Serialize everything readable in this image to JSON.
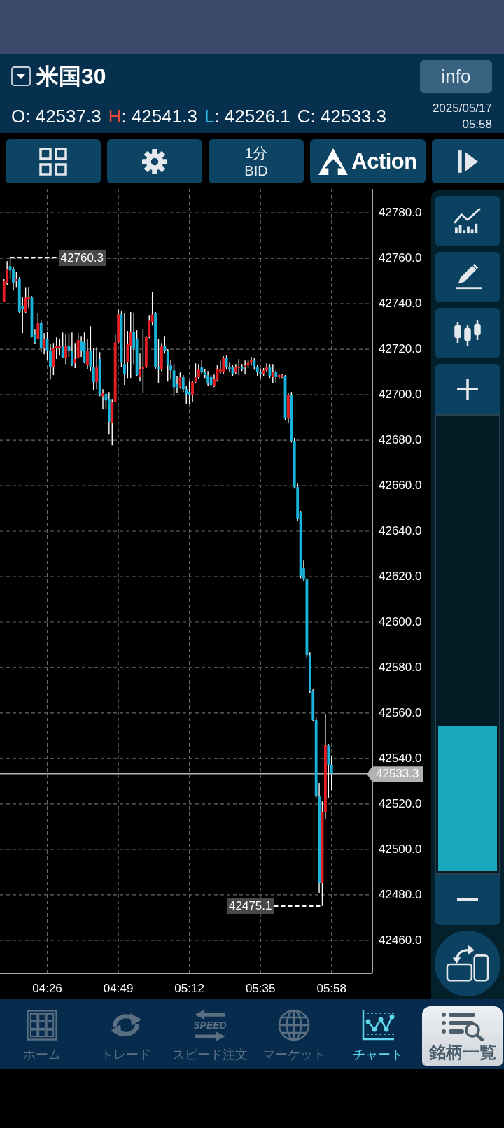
{
  "header": {
    "title": "米国30",
    "info_button": "info",
    "ohlc": [
      {
        "label": "O",
        "value": ": 42537.3",
        "color": "#ffffff"
      },
      {
        "label": "H",
        "value": ": 42541.3",
        "color": "#e8463c"
      },
      {
        "label": "L",
        "value": ": 42526.1",
        "color": "#29b6e8"
      },
      {
        "label": "C",
        "value": ": 42533.3",
        "color": "#ffffff"
      }
    ],
    "date": "2025/05/17",
    "time": "05:58"
  },
  "toolbar": [
    {
      "kind": "layout"
    },
    {
      "kind": "settings"
    },
    {
      "kind": "timeframe",
      "label": "1分",
      "sublabel": "BID"
    },
    {
      "kind": "action",
      "label": "Action"
    },
    {
      "kind": "forward"
    }
  ],
  "chart": {
    "chart_data": {
      "type": "candlestick",
      "x": [
        252,
        253,
        254,
        255,
        256,
        257,
        258,
        259,
        260,
        261,
        262,
        263,
        264,
        265,
        266,
        267,
        268,
        269,
        270,
        271,
        272,
        273,
        274,
        275,
        276,
        277,
        278,
        279,
        280,
        281,
        282,
        283,
        284,
        285,
        286,
        287,
        288,
        289,
        290,
        291,
        292,
        293,
        294,
        295,
        296,
        297,
        298,
        299,
        300,
        301,
        302,
        303,
        304,
        305,
        306,
        307,
        308,
        309,
        310,
        311,
        312,
        313,
        314,
        315,
        316,
        317,
        318,
        319,
        320,
        321,
        322,
        323,
        324,
        325,
        326,
        327,
        328,
        329,
        330,
        331,
        332,
        333,
        334,
        335,
        336,
        337,
        338,
        339,
        340,
        341,
        342,
        343,
        344,
        345,
        346,
        347,
        348,
        349,
        350,
        351,
        352,
        353,
        354,
        355,
        356,
        357,
        358
      ],
      "ohlc": [
        [
          42740.9,
          42751.0,
          42740.9,
          42750.1
        ],
        [
          42749.2,
          42758.7,
          42748.0,
          42755.3
        ],
        [
          42756.6,
          42760.3,
          42751.0,
          42754.7
        ],
        [
          42755.3,
          42756.0,
          42745.8,
          42749.2
        ],
        [
          42749.8,
          42754.1,
          42747.3,
          42751.0
        ],
        [
          42751.0,
          42751.7,
          42735.7,
          42736.3
        ],
        [
          42739.0,
          42743.0,
          42727.0,
          42737.8
        ],
        [
          42736.3,
          42747.3,
          42735.7,
          42742.7
        ],
        [
          42741.8,
          42747.3,
          42738.1,
          42743.0
        ],
        [
          42742.7,
          42743.3,
          42725.2,
          42725.5
        ],
        [
          42726.7,
          42728.9,
          42722.4,
          42723.0
        ],
        [
          42724.6,
          42736.0,
          42724.6,
          42731.7
        ],
        [
          42731.7,
          42732.6,
          42718.7,
          42720.3
        ],
        [
          42720.3,
          42727.0,
          42717.8,
          42724.6
        ],
        [
          42724.6,
          42727.7,
          42715.3,
          42719.3
        ],
        [
          42719.3,
          42722.1,
          42706.7,
          42712.0
        ],
        [
          42712.0,
          42722.7,
          42708.6,
          42720.3
        ],
        [
          42720.3,
          42725.2,
          42715.7,
          42721.5
        ],
        [
          42720.3,
          42724.3,
          42717.2,
          42721.5
        ],
        [
          42721.5,
          42727.3,
          42716.0,
          42716.3
        ],
        [
          42716.3,
          42726.4,
          42713.5,
          42721.5
        ],
        [
          42721.5,
          42727.0,
          42716.6,
          42719.3
        ],
        [
          42719.3,
          42727.3,
          42712.6,
          42712.9
        ],
        [
          42713.8,
          42722.7,
          42711.7,
          42715.7
        ],
        [
          42716.3,
          42727.0,
          42716.0,
          42724.0
        ],
        [
          42723.3,
          42725.8,
          42716.6,
          42719.3
        ],
        [
          42723.0,
          42727.3,
          42713.8,
          42714.1
        ],
        [
          42712.9,
          42724.6,
          42711.3,
          42719.3
        ],
        [
          42719.3,
          42730.1,
          42710.4,
          42712.0
        ],
        [
          42712.0,
          42720.6,
          42702.1,
          42705.5
        ],
        [
          42705.5,
          42720.9,
          42702.4,
          42712.0
        ],
        [
          42715.7,
          42718.7,
          42699.3,
          42699.7
        ],
        [
          42699.3,
          42702.4,
          42693.5,
          42700.6
        ],
        [
          42700.3,
          42700.6,
          42693.5,
          42697.5
        ],
        [
          42698.1,
          42701.2,
          42682.7,
          42688.0
        ],
        [
          42687.7,
          42698.1,
          42677.8,
          42696.6
        ],
        [
          42696.9,
          42726.4,
          42696.6,
          42723.0
        ],
        [
          42723.0,
          42737.5,
          42722.7,
          42735.3
        ],
        [
          42735.3,
          42736.6,
          42712.3,
          42714.1
        ],
        [
          42713.5,
          42736.0,
          42704.3,
          42708.9
        ],
        [
          42714.4,
          42728.0,
          42707.3,
          42722.1
        ],
        [
          42721.5,
          42736.3,
          42707.3,
          42727.7
        ],
        [
          42727.7,
          42736.0,
          42713.5,
          42720.3
        ],
        [
          42724.6,
          42728.3,
          42708.0,
          42708.6
        ],
        [
          42707.7,
          42718.1,
          42705.8,
          42711.3
        ],
        [
          42711.3,
          42728.9,
          42700.6,
          42712.3
        ],
        [
          42712.3,
          42725.8,
          42711.7,
          42725.5
        ],
        [
          42725.5,
          42735.0,
          42724.9,
          42732.6
        ],
        [
          42732.0,
          42745.2,
          42730.4,
          42735.3
        ],
        [
          42735.7,
          42736.3,
          42711.3,
          42712.0
        ],
        [
          42712.0,
          42724.6,
          42705.2,
          42711.3
        ],
        [
          42711.3,
          42722.7,
          42710.4,
          42721.5
        ],
        [
          42721.5,
          42725.8,
          42718.1,
          42719.3
        ],
        [
          42719.3,
          42720.0,
          42705.8,
          42712.9
        ],
        [
          42712.9,
          42715.3,
          42706.7,
          42710.7
        ],
        [
          42710.7,
          42713.5,
          42699.3,
          42703.3
        ],
        [
          42704.6,
          42708.0,
          42700.9,
          42703.0
        ],
        [
          42703.3,
          42709.8,
          42702.7,
          42707.7
        ],
        [
          42707.7,
          42708.6,
          42701.2,
          42702.4
        ],
        [
          42702.4,
          42704.0,
          42696.0,
          42700.3
        ],
        [
          42701.2,
          42705.8,
          42695.7,
          42699.7
        ],
        [
          42699.7,
          42706.1,
          42696.6,
          42705.5
        ],
        [
          42705.5,
          42713.8,
          42704.9,
          42707.7
        ],
        [
          42707.7,
          42713.5,
          42707.0,
          42711.3
        ],
        [
          42712.0,
          42715.0,
          42708.9,
          42709.8
        ],
        [
          42709.8,
          42711.3,
          42707.3,
          42708.6
        ],
        [
          42708.6,
          42710.4,
          42704.0,
          42704.9
        ],
        [
          42707.7,
          42708.6,
          42703.7,
          42704.3
        ],
        [
          42704.0,
          42708.9,
          42703.3,
          42707.0
        ],
        [
          42706.4,
          42712.9,
          42705.8,
          42711.3
        ],
        [
          42709.8,
          42715.0,
          42709.2,
          42711.3
        ],
        [
          42709.8,
          42716.9,
          42709.2,
          42716.3
        ],
        [
          42716.3,
          42717.2,
          42711.0,
          42712.0
        ],
        [
          42712.0,
          42714.1,
          42710.1,
          42711.3
        ],
        [
          42712.0,
          42712.9,
          42708.3,
          42709.2
        ],
        [
          42709.8,
          42713.5,
          42709.2,
          42712.3
        ],
        [
          42711.7,
          42715.7,
          42708.6,
          42712.3
        ],
        [
          42712.3,
          42713.5,
          42710.4,
          42711.3
        ],
        [
          42712.0,
          42715.0,
          42709.2,
          42712.9
        ],
        [
          42712.9,
          42715.3,
          42711.7,
          42714.1
        ],
        [
          42714.1,
          42716.6,
          42712.9,
          42715.3
        ],
        [
          42715.3,
          42716.0,
          42711.0,
          42712.3
        ],
        [
          42712.3,
          42713.2,
          42708.0,
          42709.8
        ],
        [
          42709.8,
          42711.3,
          42707.3,
          42709.2
        ],
        [
          42709.2,
          42711.7,
          42708.3,
          42710.7
        ],
        [
          42710.7,
          42713.8,
          42710.1,
          42712.3
        ],
        [
          42712.3,
          42713.5,
          42707.3,
          42708.0
        ],
        [
          42707.7,
          42713.5,
          42705.2,
          42710.1
        ],
        [
          42710.1,
          42710.7,
          42705.5,
          42707.7
        ],
        [
          42707.7,
          42709.2,
          42707.0,
          42708.6
        ],
        [
          42707.7,
          42709.2,
          42707.3,
          42708.6
        ],
        [
          42708.3,
          42708.6,
          42688.9,
          42689.5
        ],
        [
          42689.5,
          42700.9,
          42687.3,
          42699.7
        ],
        [
          42700.0,
          42701.2,
          42679.0,
          42679.7
        ],
        [
          42679.7,
          42680.9,
          42658.7,
          42659.3
        ],
        [
          42659.3,
          42661.2,
          42644.3,
          42645.5
        ],
        [
          42648.3,
          42648.9,
          42619.3,
          42620.3
        ],
        [
          42623.6,
          42627.3,
          42618.1,
          42618.7
        ],
        [
          42618.7,
          42619.3,
          42584.3,
          42585.5
        ],
        [
          42585.5,
          42586.7,
          42568.9,
          42569.5
        ],
        [
          42569.5,
          42570.4,
          42556.6,
          42556.9
        ],
        [
          42556.9,
          42558.1,
          42522.7,
          42523.3
        ],
        [
          42523.3,
          42529.2,
          42480.9,
          42485.2
        ],
        [
          42485.2,
          42521.2,
          42475.1,
          42516.6
        ],
        [
          42516.6,
          42559.6,
          42513.2,
          42545.8
        ],
        [
          42545.8,
          42546.4,
          42522.7,
          42537.3
        ],
        [
          42537.3,
          42541.3,
          42526.1,
          42533.3
        ]
      ],
      "xlim": [
        250.7,
        371.2
      ],
      "ylim": [
        42445.5,
        42790.5
      ],
      "grid": true,
      "xticks": [
        {
          "value": 266,
          "label": "04:26"
        },
        {
          "value": 289,
          "label": "04:49"
        },
        {
          "value": 312,
          "label": "05:12"
        },
        {
          "value": 335,
          "label": "05:35"
        },
        {
          "value": 358,
          "label": "05:58"
        }
      ],
      "yticks": [
        {
          "value": 42780,
          "label": "42780.0"
        },
        {
          "value": 42760,
          "label": "42760.0"
        },
        {
          "value": 42740,
          "label": "42740.0"
        },
        {
          "value": 42720,
          "label": "42720.0"
        },
        {
          "value": 42700,
          "label": "42700.0"
        },
        {
          "value": 42680,
          "label": "42680.0"
        },
        {
          "value": 42660,
          "label": "42660.0"
        },
        {
          "value": 42640,
          "label": "42640.0"
        },
        {
          "value": 42620,
          "label": "42620.0"
        },
        {
          "value": 42600,
          "label": "42600.0"
        },
        {
          "value": 42580,
          "label": "42580.0"
        },
        {
          "value": 42560,
          "label": "42560.0"
        },
        {
          "value": 42540,
          "label": "42540.0"
        },
        {
          "value": 42520,
          "label": "42520.0"
        },
        {
          "value": 42500,
          "label": "42500.0"
        },
        {
          "value": 42480,
          "label": "42480.0"
        },
        {
          "value": 42460,
          "label": "42460.0"
        }
      ],
      "annotations": [
        {
          "x": 254,
          "y": 42760.3,
          "text": "42760.3"
        },
        {
          "x": 355,
          "y": 42475.1,
          "text": "42475.1"
        }
      ],
      "ref_lines": [
        {
          "axis": "y",
          "value": 42533.3,
          "label": "42533.3"
        }
      ]
    }
  },
  "side_tools": {
    "buttons": [
      {
        "kind": "indicator"
      },
      {
        "kind": "drawing"
      },
      {
        "kind": "chart_type"
      }
    ],
    "zoom": {
      "level": 0.32
    }
  },
  "bottom_nav": {
    "items": [
      {
        "kind": "home",
        "label": "ホーム",
        "selected": false
      },
      {
        "kind": "trade",
        "label": "トレード",
        "selected": false
      },
      {
        "kind": "speed_order",
        "label": "スピード注文",
        "icon_text": "SPEED",
        "selected": false
      },
      {
        "kind": "market",
        "label": "マーケット",
        "selected": false
      },
      {
        "kind": "chart",
        "label": "チャート",
        "selected": true
      }
    ],
    "symbol_list_button": "銘柄一覧"
  }
}
